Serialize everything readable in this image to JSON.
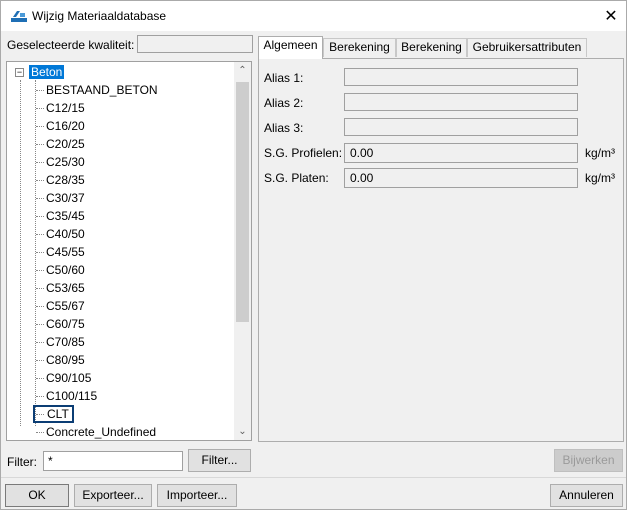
{
  "window": {
    "title": "Wijzig Materiaaldatabase",
    "close_glyph": "✕",
    "app_icon": "material-database-icon"
  },
  "selected_quality": {
    "label": "Geselecteerde kwaliteit:",
    "value": ""
  },
  "tree": {
    "root": "Beton",
    "root_expander": "−",
    "items": [
      "BESTAAND_BETON",
      "C12/15",
      "C16/20",
      "C20/25",
      "C25/30",
      "C28/35",
      "C30/37",
      "C35/45",
      "C40/50",
      "C45/55",
      "C50/60",
      "C53/65",
      "C55/67",
      "C60/75",
      "C70/85",
      "C80/95",
      "C90/105",
      "C100/115",
      "CLT",
      "Concrete_Undefined"
    ],
    "focused_item": "CLT",
    "scroll_up": "⌃",
    "scroll_down": "⌄"
  },
  "tabs": [
    "Algemeen",
    "Berekening",
    "Berekening",
    "Gebruikersattributen"
  ],
  "active_tab": "Algemeen",
  "form": {
    "alias1_label": "Alias 1:",
    "alias1_value": "",
    "alias2_label": "Alias 2:",
    "alias2_value": "",
    "alias3_label": "Alias 3:",
    "alias3_value": "",
    "sg_profielen_label": "S.G. Profielen:",
    "sg_profielen_value": "0.00",
    "sg_profielen_unit": "kg/m³",
    "sg_platen_label": "S.G. Platen:",
    "sg_platen_value": "0.00",
    "sg_platen_unit": "kg/m³"
  },
  "filter": {
    "label": "Filter:",
    "value": "*",
    "button": "Filter..."
  },
  "buttons": {
    "bijwerken": "Bijwerken",
    "ok": "OK",
    "exporteer": "Exporteer...",
    "importeer": "Importeer...",
    "annuleren": "Annuleren"
  }
}
